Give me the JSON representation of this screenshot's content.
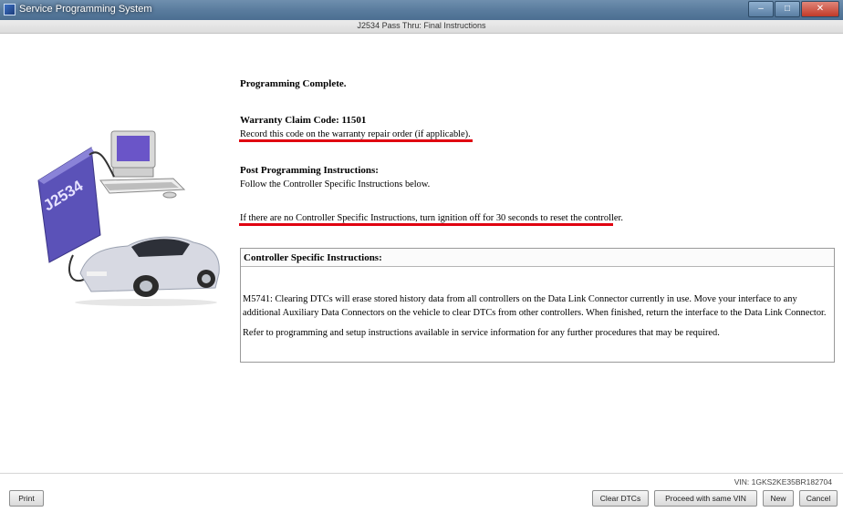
{
  "window": {
    "app_title": "Service Programming System",
    "controls": {
      "minimize": "–",
      "maximize": "□",
      "close": "✕"
    }
  },
  "header": {
    "title": "J2534 Pass Thru: Final Instructions"
  },
  "illustration": {
    "device_label": "J2534"
  },
  "content": {
    "programming_complete": "Programming Complete.",
    "warranty_claim_code": "Warranty Claim Code: 11501",
    "record_note": "Record this code on the warranty repair order (if applicable).",
    "post_programming_title": "Post Programming Instructions:",
    "follow_note": "Follow the Controller Specific Instructions below.",
    "ignition_note": "If there are no Controller Specific Instructions, turn ignition off for 30 seconds to reset the controller."
  },
  "controller_specific": {
    "title": "Controller Specific Instructions:",
    "paragraphs": [
      "M5741: Clearing DTCs will erase stored history data from all controllers on the Data Link Connector currently in use. Move your interface to any additional Auxiliary Data Connectors on the vehicle to clear DTCs from other controllers. When finished, return the interface to the Data Link Connector.",
      "Refer to programming and setup instructions available in service information for any further procedures that may be required."
    ]
  },
  "footer": {
    "vin": "VIN: 1GKS2KE35BR182704",
    "buttons": {
      "print": "Print",
      "clear_dtcs": "Clear DTCs",
      "proceed_same_vin": "Proceed with same VIN",
      "new": "New",
      "cancel": "Cancel"
    }
  },
  "colors": {
    "underline": "#e00010",
    "titlebar": "#5a7c9e"
  }
}
